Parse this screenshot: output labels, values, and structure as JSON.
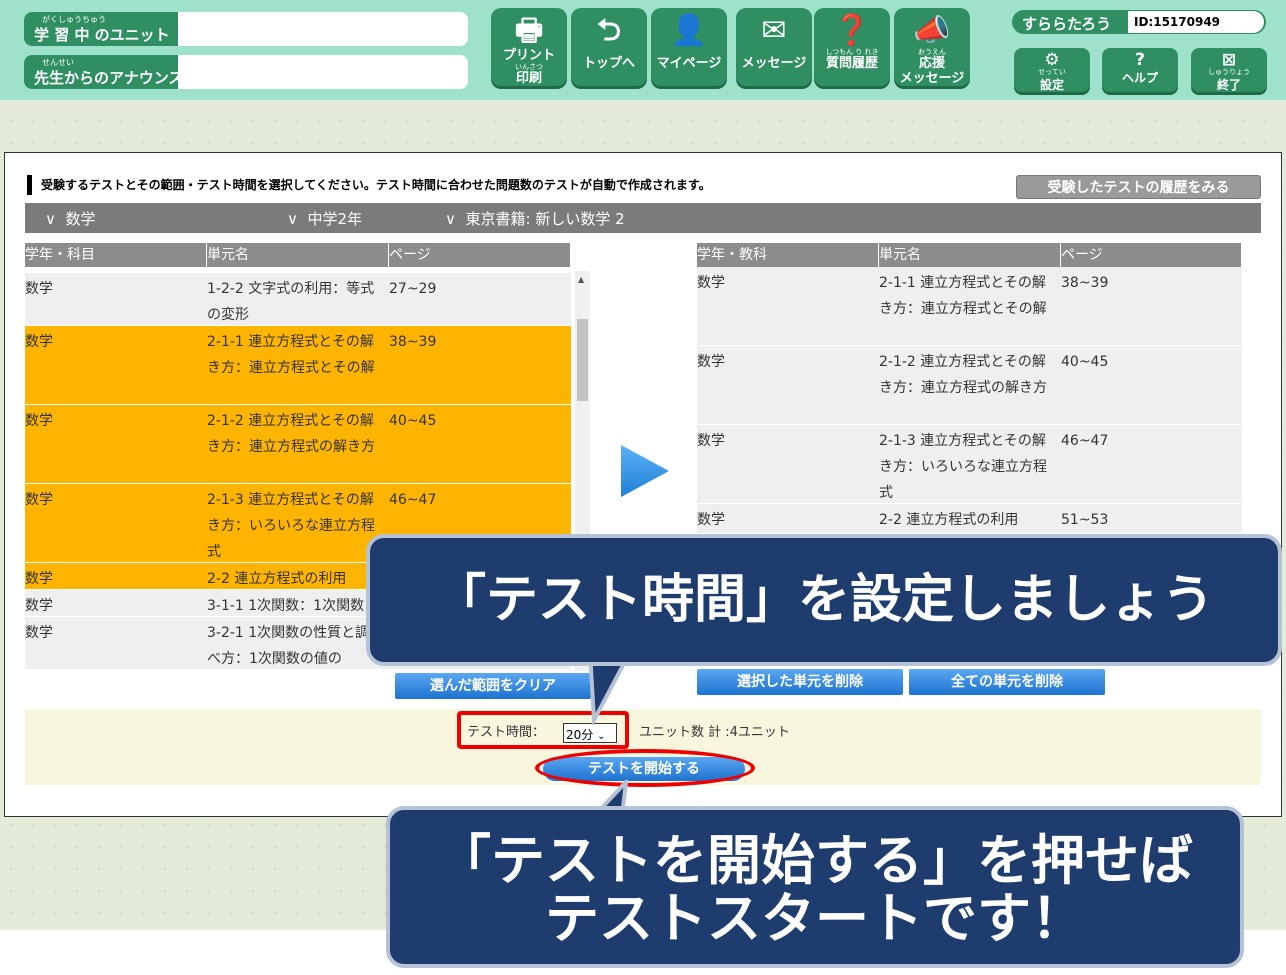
{
  "header": {
    "unit_label": "学 習 中 のユニット",
    "unit_ruby": "がくしゅうちゅう",
    "announce_label": "先生からのアナウンス",
    "announce_ruby": "せんせい",
    "nav": [
      {
        "label": "プリント",
        "sub": "印刷",
        "ruby": "いんさつ",
        "icon": "printer-icon"
      },
      {
        "label": "トップへ",
        "icon": "return-arrow-icon"
      },
      {
        "label": "マイページ",
        "icon": "person-icon"
      },
      {
        "label": "メッセージ",
        "icon": "envelope-icon"
      },
      {
        "label": "質問履歴",
        "ruby": "しつもん り れき",
        "icon": "question-bubble-icon"
      },
      {
        "label": "応援",
        "sub": "メッセージ",
        "ruby": "おうえん",
        "icon": "megaphone-icon"
      }
    ],
    "user_name": "すららたろう",
    "user_id": "ID:15170949",
    "small": [
      {
        "label": "設定",
        "ruby": "せってい",
        "icon": "gear-icon"
      },
      {
        "label": "ヘルプ",
        "icon": "help-icon"
      },
      {
        "label": "終了",
        "ruby": "しゅうりょう",
        "icon": "close-icon"
      }
    ]
  },
  "main": {
    "instruction": "受験するテストとその範囲・テスト時間を選択してください。テスト時間に合わせた問題数のテストが自動で作成されます。",
    "history_button": "受験したテストの履歴をみる",
    "filters": [
      "数学",
      "中学2年",
      "東京書籍: 新しい数学 2"
    ],
    "left_headers": [
      "学年・科目",
      "単元名",
      "ページ"
    ],
    "right_headers": [
      "学年・教科",
      "単元名",
      "ページ"
    ],
    "left_rows": [
      {
        "subject": "数学",
        "unit": "1-2-2 文字式の利用：等式の変形",
        "page": "27~29",
        "selected": false
      },
      {
        "subject": "数学",
        "unit": "2-1-1 連立方程式とその解き方：連立方程式とその解",
        "page": "38~39",
        "selected": true
      },
      {
        "subject": "数学",
        "unit": "2-1-2 連立方程式とその解き方：連立方程式の解き方",
        "page": "40~45",
        "selected": true
      },
      {
        "subject": "数学",
        "unit": "2-1-3 連立方程式とその解き方：いろいろな連立方程式",
        "page": "46~47",
        "selected": true
      },
      {
        "subject": "数学",
        "unit": "2-2 連立方程式の利用",
        "page": "",
        "selected": true
      },
      {
        "subject": "数学",
        "unit": "3-1-1 1次関数：1次関数",
        "page": "",
        "selected": false
      },
      {
        "subject": "数学",
        "unit": "3-2-1 1次関数の性質と調べ方：1次関数の値の",
        "page": "",
        "selected": false
      }
    ],
    "right_rows": [
      {
        "subject": "数学",
        "unit": "2-1-1 連立方程式とその解き方：連立方程式とその解",
        "page": "38~39"
      },
      {
        "subject": "数学",
        "unit": "2-1-2 連立方程式とその解き方：連立方程式の解き方",
        "page": "40~45"
      },
      {
        "subject": "数学",
        "unit": "2-1-3 連立方程式とその解き方：いろいろな連立方程式",
        "page": "46~47"
      },
      {
        "subject": "数学",
        "unit": "2-2 連立方程式の利用",
        "page": "51~53"
      }
    ],
    "clear_button": "選んだ範囲をクリア",
    "delete_selected_button": "選択した単元を削除",
    "delete_all_button": "全ての単元を削除",
    "test_time_label": "テスト時間：",
    "test_time_value": "20分",
    "unit_count": "ユニット数 計 :4ユニット",
    "start_button": "テストを開始する"
  },
  "callouts": {
    "top": "「テスト時間」を設定しましょう",
    "bottom_line1": "「テストを開始する」を押せば",
    "bottom_line2": "テストスタートです！"
  },
  "colors": {
    "header": "#9ee2cc",
    "accent_green": "#2f8f63",
    "selected_row": "#ffb400",
    "callout": "#1e3d6e",
    "highlight": "#ee0000"
  }
}
